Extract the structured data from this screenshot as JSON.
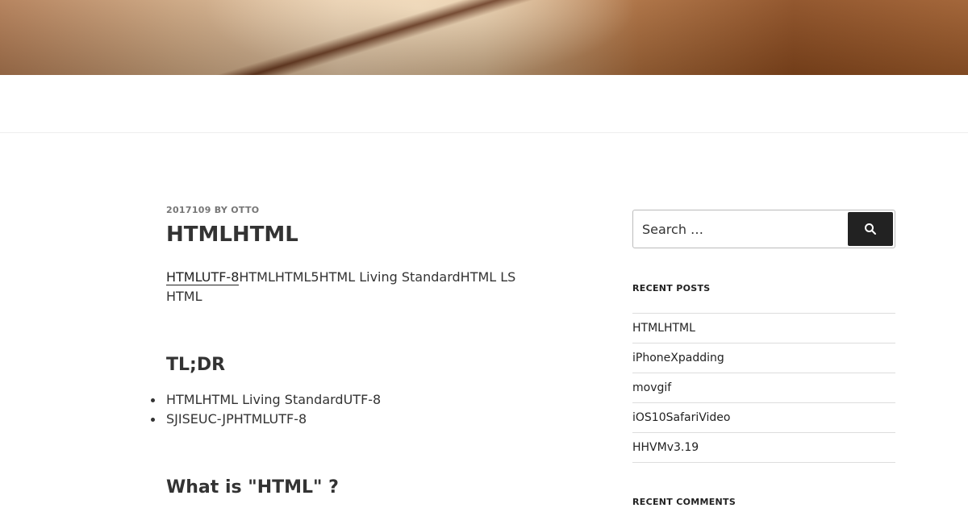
{
  "post": {
    "meta": "2017109 BY OTTO",
    "title": "HTMLHTML",
    "intro_link": "HTMLUTF-8",
    "intro_rest": "HTMLHTML5HTML Living StandardHTML LS HTML",
    "tldr_heading": "TL;DR",
    "bullets": [
      "HTMLHTML Living StandardUTF-8",
      "SJISEUC-JPHTMLUTF-8"
    ],
    "what_heading": "What is \"HTML\" ?"
  },
  "sidebar": {
    "search": {
      "placeholder": "Search …",
      "button_icon": "search-icon"
    },
    "recent_posts_title": "RECENT POSTS",
    "recent_posts": [
      "HTMLHTML",
      "iPhoneXpadding",
      "movgif",
      "iOS10SafariVideo",
      "HHVMv3.19"
    ],
    "recent_comments_title": "RECENT COMMENTS"
  }
}
